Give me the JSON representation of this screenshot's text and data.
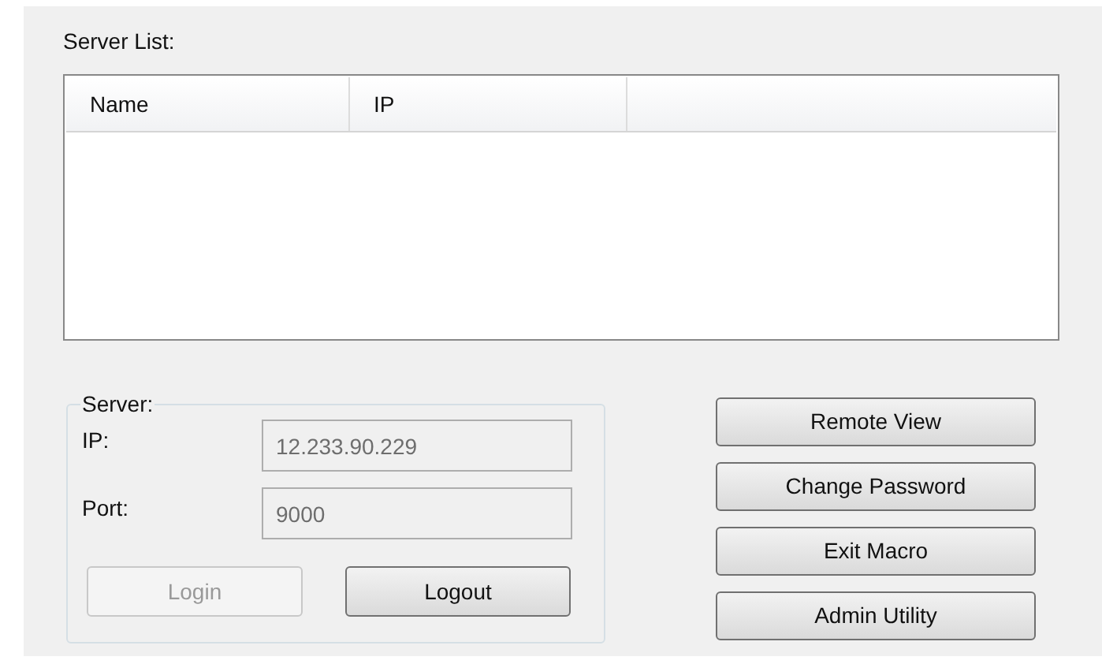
{
  "server_list": {
    "label": "Server List:",
    "columns": [
      "Name",
      "IP"
    ]
  },
  "server": {
    "label": "Server:",
    "fields": [
      {
        "label": "IP:",
        "value": "12.233.90.229",
        "disabled": true
      },
      {
        "label": "Port:",
        "value": "9000",
        "disabled": true
      }
    ],
    "buttons": [
      {
        "label": "Login",
        "disabled": true
      },
      {
        "label": "Logout",
        "disabled": false
      }
    ]
  },
  "actions": [
    {
      "label": "Remote View"
    },
    {
      "label": "Change Password"
    },
    {
      "label": "Exit Macro"
    },
    {
      "label": "Admin Utility"
    }
  ]
}
